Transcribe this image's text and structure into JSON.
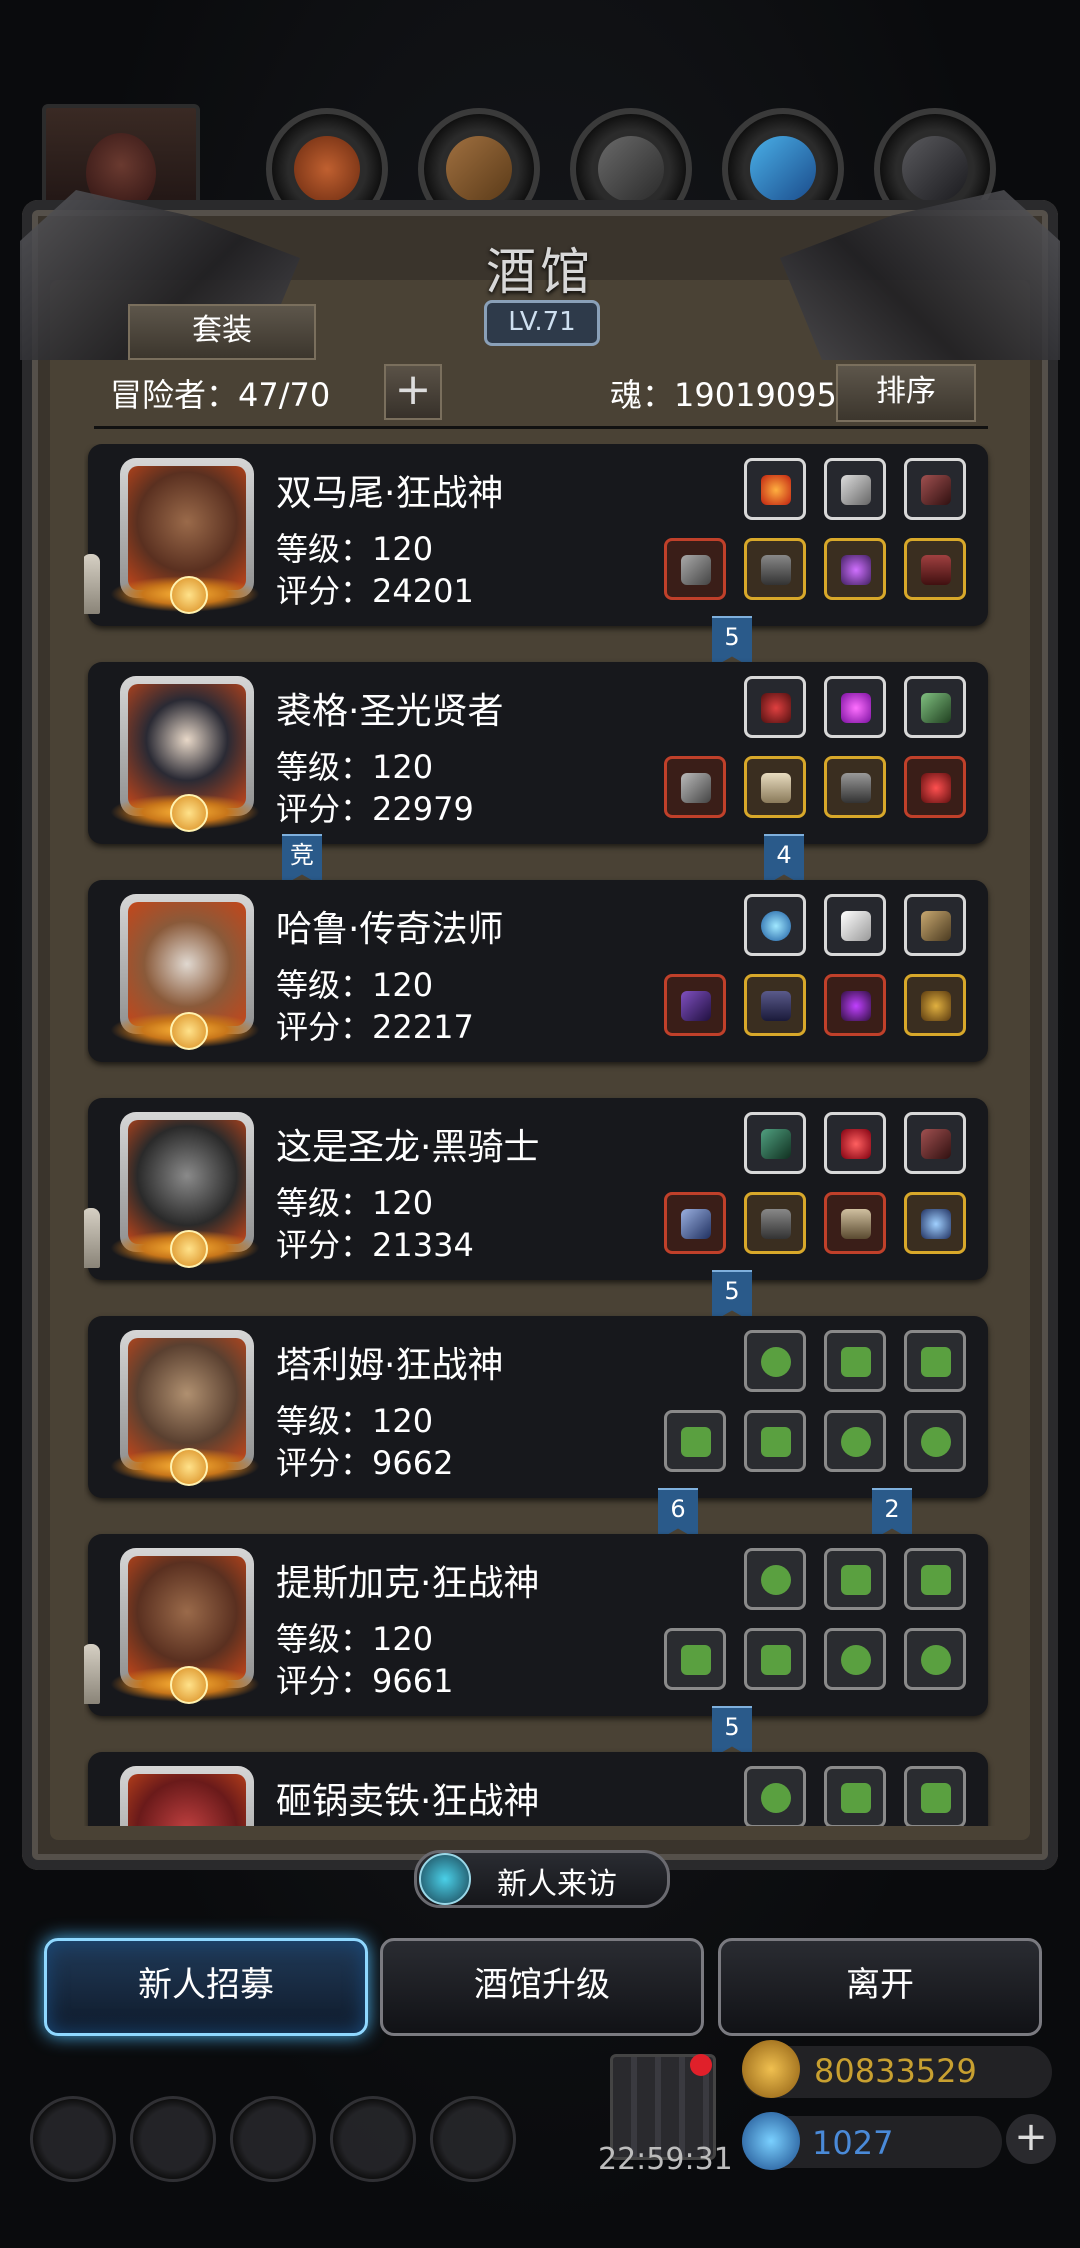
{
  "header": {
    "title": "酒馆",
    "level": "LV.71",
    "suit_button": "套装",
    "adventurers_label": "冒险者：47/70",
    "plus": "+",
    "soul_label": "魂：19019095",
    "sort_button": "排序"
  },
  "heroes": [
    {
      "name": "双马尾·狂战神",
      "level": "等级：120",
      "score": "评分：24201"
    },
    {
      "name": "裘格·圣光贤者",
      "level": "等级：120",
      "score": "评分：22979"
    },
    {
      "name": "哈鲁·传奇法师",
      "level": "等级：120",
      "score": "评分：22217"
    },
    {
      "name": "这是圣龙·黑骑士",
      "level": "等级：120",
      "score": "评分：21334"
    },
    {
      "name": "塔利姆·狂战神",
      "level": "等级：120",
      "score": "评分：9662"
    },
    {
      "name": "提斯加克·狂战神",
      "level": "等级：120",
      "score": "评分：9661"
    },
    {
      "name": "砸锅卖铁·狂战神"
    }
  ],
  "ribbons": [
    "5",
    "竞",
    "4",
    "5",
    "6",
    "2",
    "5"
  ],
  "visit_label": "新人来访",
  "buttons": {
    "recruit": "新人招募",
    "upgrade": "酒馆升级",
    "leave": "离开"
  },
  "hud": {
    "clock": "22:59:31",
    "gold": "80833529",
    "gems": "1027",
    "plus": "+"
  },
  "colors": {
    "accent_blue": "#4aaee8",
    "gold_text": "#c8a030",
    "gem_text": "#4a8ad8"
  }
}
